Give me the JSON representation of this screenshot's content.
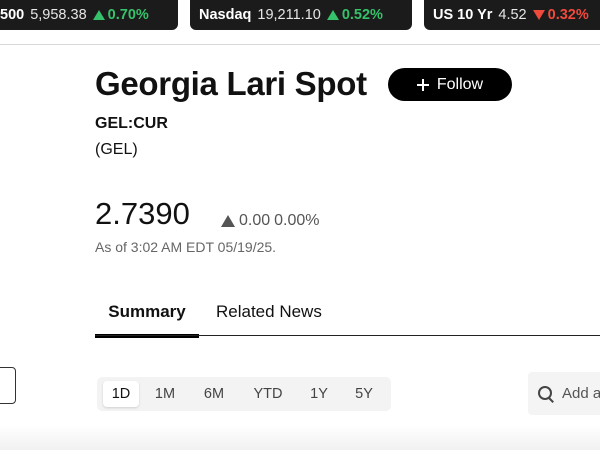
{
  "ticker_strip": [
    {
      "name": "500",
      "value": "5,958.38",
      "change": "0.70%",
      "direction": "up"
    },
    {
      "name": "Nasdaq",
      "value": "19,211.10",
      "change": "0.52%",
      "direction": "up"
    },
    {
      "name": "US 10 Yr",
      "value": "4.52",
      "change": "0.32%",
      "direction": "down"
    }
  ],
  "colors": {
    "up": "#35c26a",
    "down": "#f04a3c",
    "ticker_bg": "#1b1b1b"
  },
  "header": {
    "title": "Georgia Lari Spot",
    "follow_label": "Follow",
    "follow_icon": "plus-icon",
    "ticker_symbol": "GEL:CUR",
    "currency_code": "(GEL)"
  },
  "quote": {
    "price": "2.7390",
    "change": "0.00",
    "change_pct": "0.00%",
    "change_direction": "up",
    "as_of": "As of 3:02 AM EDT 05/19/25."
  },
  "tabs": [
    {
      "label": "Summary",
      "active": true
    },
    {
      "label": "Related News",
      "active": false
    }
  ],
  "chart_controls": {
    "ranges": [
      "1D",
      "1M",
      "6M",
      "YTD",
      "1Y",
      "5Y"
    ],
    "selected_range": "1D",
    "search_placeholder": "Add a",
    "search_icon": "search-icon"
  }
}
